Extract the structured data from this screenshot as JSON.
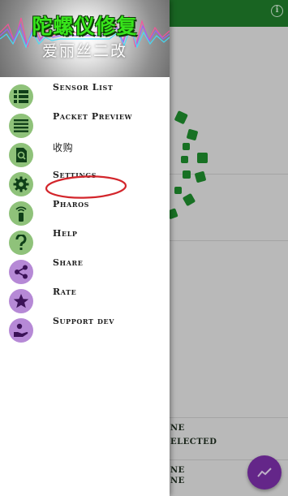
{
  "background": {
    "info_glyph": "i",
    "text_lines": [
      "NE",
      "ELECTED",
      "NE",
      "NE"
    ]
  },
  "drawer": {
    "title": "陀螺仪修复",
    "subtitle": "爱丽丝二改",
    "items": [
      {
        "label": "Sensor List",
        "icon": "list-icon"
      },
      {
        "label": "Packet Preview",
        "icon": "lines-icon"
      },
      {
        "label": "收购",
        "icon": "search-document-icon"
      },
      {
        "label": "Settings",
        "icon": "gear-icon"
      },
      {
        "label": "Pharos",
        "icon": "remote-icon"
      },
      {
        "label": "Help",
        "icon": "question-icon"
      },
      {
        "label": "Share",
        "icon": "share-icon"
      },
      {
        "label": "Rate",
        "icon": "star-icon"
      },
      {
        "label": "Support dev",
        "icon": "donate-hand-icon"
      }
    ]
  },
  "colors": {
    "accent_green": "#1f7a2a",
    "icon_green": "#8fc27a",
    "icon_purple": "#b689d6",
    "title_green": "#38e51b",
    "highlight_red": "#d3252b",
    "fab_purple": "#7b2fa8"
  }
}
